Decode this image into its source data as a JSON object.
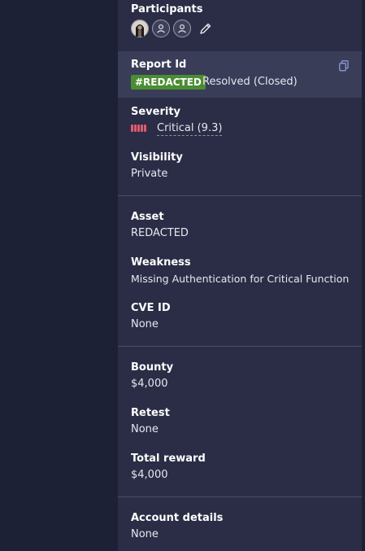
{
  "participants": {
    "label": "Participants",
    "avatars": [
      "user-photo",
      "default-avatar",
      "default-avatar"
    ],
    "edit_icon": "pencil-icon"
  },
  "report": {
    "label": "Report Id",
    "id_badge": "#REDACTED",
    "status": "Resolved (Closed)",
    "copy_icon": "copy-icon",
    "badge_color": "#4a8d32"
  },
  "severity": {
    "label": "Severity",
    "value": "Critical (9.3)",
    "color": "#e05a6f",
    "level": 5
  },
  "visibility": {
    "label": "Visibility",
    "value": "Private"
  },
  "asset": {
    "label": "Asset",
    "value": "REDACTED"
  },
  "weakness": {
    "label": "Weakness",
    "value": "Missing Authentication for Critical Function"
  },
  "cve": {
    "label": "CVE ID",
    "value": "None"
  },
  "bounty": {
    "label": "Bounty",
    "value": "$4,000"
  },
  "retest": {
    "label": "Retest",
    "value": "None"
  },
  "total_reward": {
    "label": "Total reward",
    "value": "$4,000"
  },
  "account": {
    "label": "Account details",
    "value": "None"
  }
}
